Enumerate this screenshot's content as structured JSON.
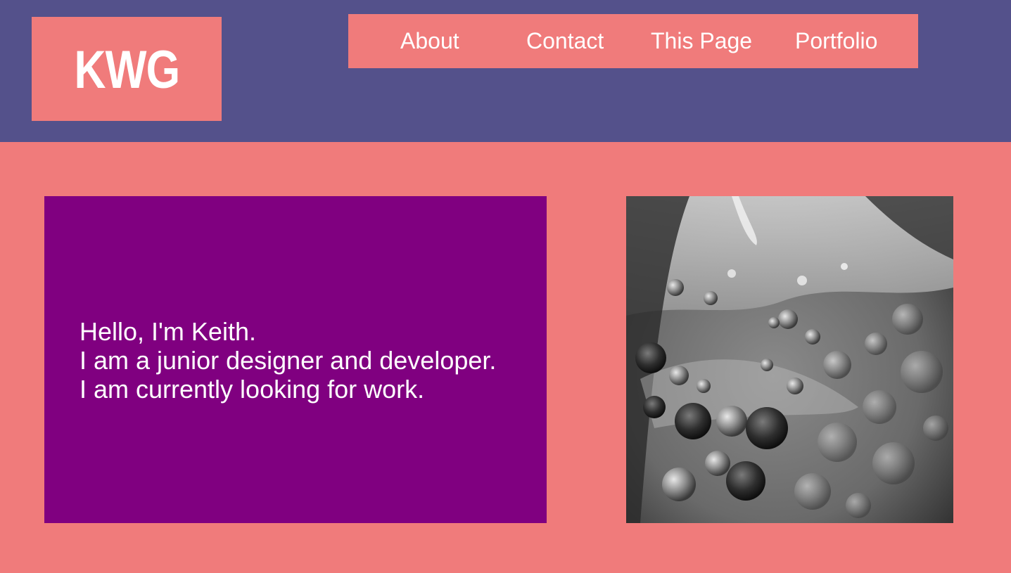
{
  "logo": {
    "text": "KWG"
  },
  "nav": {
    "items": [
      {
        "label": "About"
      },
      {
        "label": "Contact"
      },
      {
        "label": "This Page"
      },
      {
        "label": "Portfolio"
      }
    ]
  },
  "intro": {
    "lines": [
      "Hello, I'm Keith.",
      "I am a junior designer and developer.",
      "I am currently looking for work."
    ]
  },
  "colors": {
    "header_background": "#54518b",
    "page_background": "#f07b7b",
    "intro_background": "#800080",
    "text": "#ffffff"
  },
  "image": {
    "semantic": "grayscale-oil-and-water-bubbles-photo"
  }
}
